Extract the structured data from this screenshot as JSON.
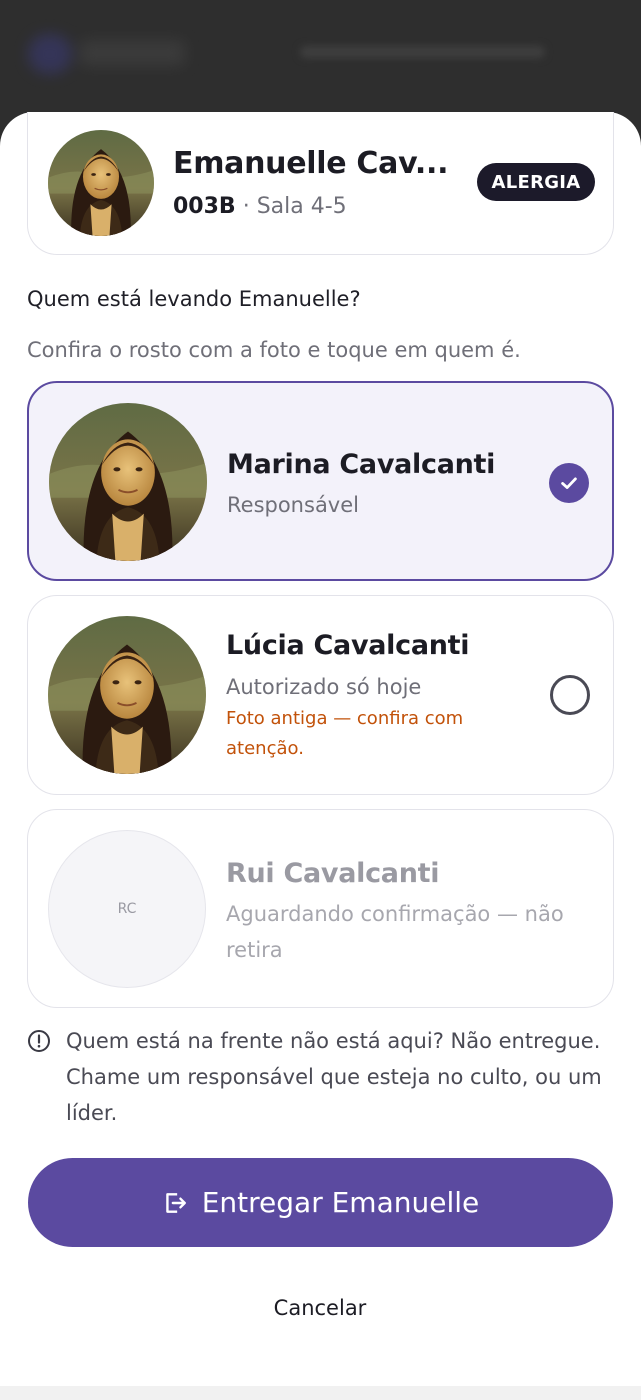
{
  "child": {
    "name": "Emanuelle Cav...",
    "code": "003B",
    "separator": " · ",
    "room": "Sala 4-5",
    "badge": "ALERGIA",
    "photo_icon": "portrait-photo"
  },
  "prompt": {
    "question": "Quem está levando Emanuelle?",
    "instruction": "Confira o rosto com a foto e toque em quem é."
  },
  "guardians": [
    {
      "name": "Marina Cavalcanti",
      "role": "Responsável",
      "warning": "",
      "state": "selected",
      "photo_icon": "portrait-photo"
    },
    {
      "name": "Lúcia Cavalcanti",
      "role": "Autorizado só hoje",
      "warning": "Foto antiga — confira com atenção.",
      "state": "unselected",
      "photo_icon": "portrait-photo"
    },
    {
      "name": "Rui Cavalcanti",
      "role": "Aguardando confirmação — não retira",
      "warning": "",
      "state": "disabled",
      "initials": "RC"
    }
  ],
  "notice": {
    "icon": "info-circle-icon",
    "text": "Quem está na frente não está aqui? Não entregue. Chame um responsável que esteja no culto, ou um líder."
  },
  "actions": {
    "primary_label": "Entregar Emanuelle",
    "primary_icon": "exit-icon",
    "cancel_label": "Cancelar"
  },
  "colors": {
    "accent": "#5b4aa0",
    "warning": "#c2520a",
    "badge_bg": "#1c1a2a"
  }
}
